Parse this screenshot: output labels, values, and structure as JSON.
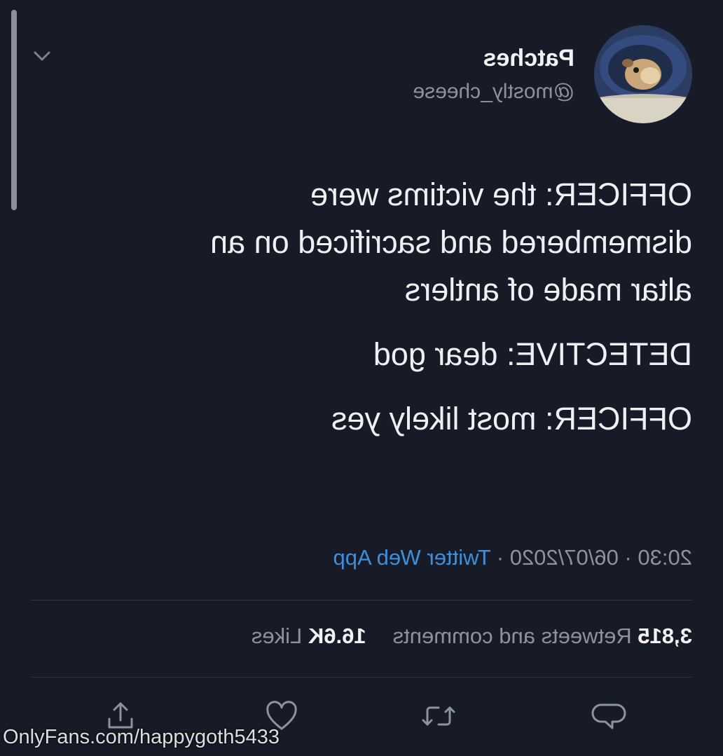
{
  "profile": {
    "name": "Patches",
    "handle": "@mostly_cheese"
  },
  "tweet": {
    "lines": [
      "OFFICER: the victims were",
      "dismembered and sacrificed on an",
      "altar made of antlers",
      "DETECTIVE: dear god",
      "OFFICER: most likely yes"
    ]
  },
  "meta": {
    "time": "20:30",
    "date": "06/07/2020",
    "separator": " · ",
    "source": "Twitter Web App"
  },
  "stats": {
    "retweets_count": "3,815",
    "retweets_label": "Retweets and comments",
    "likes_count": "16.6K",
    "likes_label": "Likes"
  },
  "actions": {
    "icons": [
      "reply-icon",
      "retweet-icon",
      "like-icon",
      "share-icon"
    ]
  },
  "watermark": {
    "text": "OnlyFans.com/happygoth5433"
  },
  "colors": {
    "background": "#161b27",
    "link": "#3d8fdc",
    "muted": "#8b939f"
  }
}
